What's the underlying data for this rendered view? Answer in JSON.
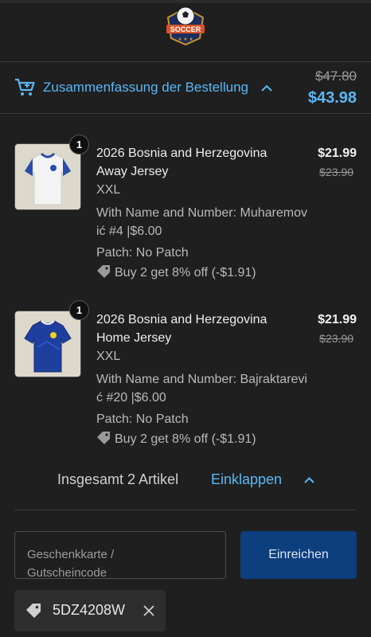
{
  "brand": {
    "logo_text": "SOCCER"
  },
  "summary": {
    "label": "Zusammenfassung der Bestellung",
    "old_total": "$47.80",
    "new_total": "$43.98",
    "accent": "#58b8f5"
  },
  "items": [
    {
      "quantity": "1",
      "title": "2026 Bosnia and Herzegovina Away Jersey",
      "size": "XXL",
      "name_number": "With Name and Number:  Muharemović #4 |$6.00",
      "patch": "Patch:  No Patch",
      "discount": "Buy 2 get 8% off (-$1.91)",
      "price": "$21.99",
      "old_price": "$23.90",
      "jersey_color": "#f2f2f2"
    },
    {
      "quantity": "1",
      "title": "2026 Bosnia and Herzegovina Home Jersey",
      "size": "XXL",
      "name_number": "With Name and Number:  Bajraktarević #20 |$6.00",
      "patch": "Patch:  No Patch",
      "discount": "Buy 2 get 8% off (-$1.91)",
      "price": "$21.99",
      "old_price": "$23.90",
      "jersey_color": "#1e3f9e"
    }
  ],
  "totals": {
    "count_label": "Insgesamt 2 Artikel",
    "collapse_label": "Einklappen"
  },
  "gift": {
    "placeholder": "Geschenkkarte / Gutscheincode",
    "submit_label": "Einreichen",
    "button_color": "#0d3e7e"
  },
  "applied_code": {
    "code": "5DZ4208W"
  }
}
